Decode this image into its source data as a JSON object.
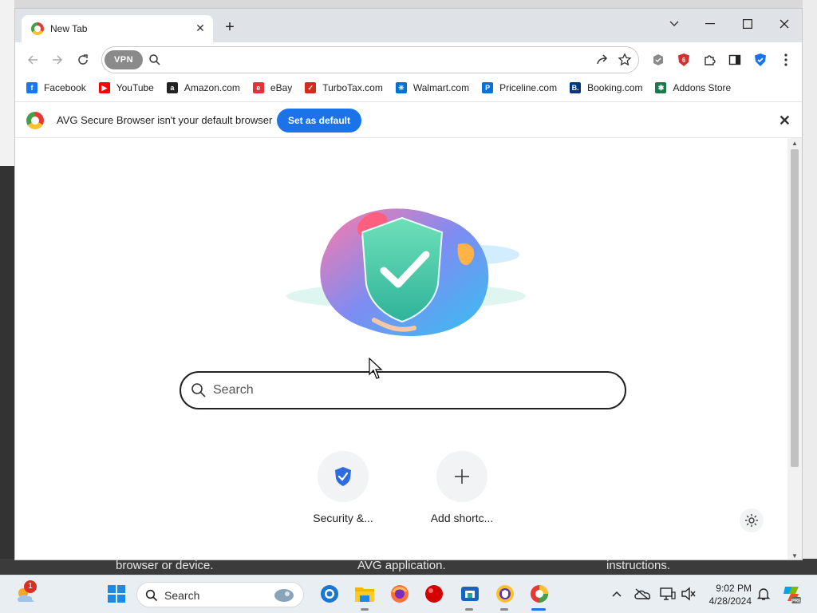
{
  "browser": {
    "tab_title": "New Tab",
    "tab_close": "✕",
    "new_tab": "+",
    "window_controls": {
      "dropdown": "⌄",
      "minimize": "—",
      "maximize": "☐",
      "close": "✕"
    }
  },
  "toolbar": {
    "vpn_label": "VPN",
    "address_value": "",
    "icons": [
      "back-icon",
      "forward-icon",
      "reload-icon",
      "share-icon",
      "star-icon",
      "shield-extension-icon",
      "adblock-icon",
      "puzzle-extensions-icon",
      "side-panel-icon",
      "avg-shield-icon",
      "menu-icon"
    ]
  },
  "bookmarks": [
    {
      "label": "Facebook",
      "icon": "facebook-icon",
      "color": "#1877f2",
      "glyph": "f"
    },
    {
      "label": "YouTube",
      "icon": "youtube-icon",
      "color": "#ff0000",
      "glyph": "▶"
    },
    {
      "label": "Amazon.com",
      "icon": "amazon-icon",
      "color": "#222222",
      "glyph": "a"
    },
    {
      "label": "eBay",
      "icon": "ebay-icon",
      "color": "#e53238",
      "glyph": "e"
    },
    {
      "label": "TurboTax.com",
      "icon": "turbotax-icon",
      "color": "#d52b1e",
      "glyph": "✓"
    },
    {
      "label": "Walmart.com",
      "icon": "walmart-icon",
      "color": "#0071ce",
      "glyph": "✳"
    },
    {
      "label": "Priceline.com",
      "icon": "priceline-icon",
      "color": "#0a6fd6",
      "glyph": "P"
    },
    {
      "label": "Booking.com",
      "icon": "booking-icon",
      "color": "#003580",
      "glyph": "B."
    },
    {
      "label": "Addons Store",
      "icon": "addons-store-icon",
      "color": "#1b7a4b",
      "glyph": "✱"
    }
  ],
  "infobar": {
    "message": "AVG Secure Browser isn't your default browser",
    "button": "Set as default",
    "close": "✕"
  },
  "newtab": {
    "search_placeholder": "Search",
    "shortcuts": [
      {
        "label": "Security &...",
        "icon": "shield-check-icon"
      },
      {
        "label": "Add shortc...",
        "icon": "plus-icon"
      }
    ]
  },
  "background": {
    "texts": [
      "browser or device.",
      "AVG application.",
      "instructions."
    ]
  },
  "taskbar": {
    "search_label": "Search",
    "weather_badge": "1",
    "time": "9:02 PM",
    "date": "4/28/2024"
  },
  "colors": {
    "accent": "#1a73e8",
    "tab_strip": "#dfe3e8",
    "taskbar": "#e9eef3"
  }
}
